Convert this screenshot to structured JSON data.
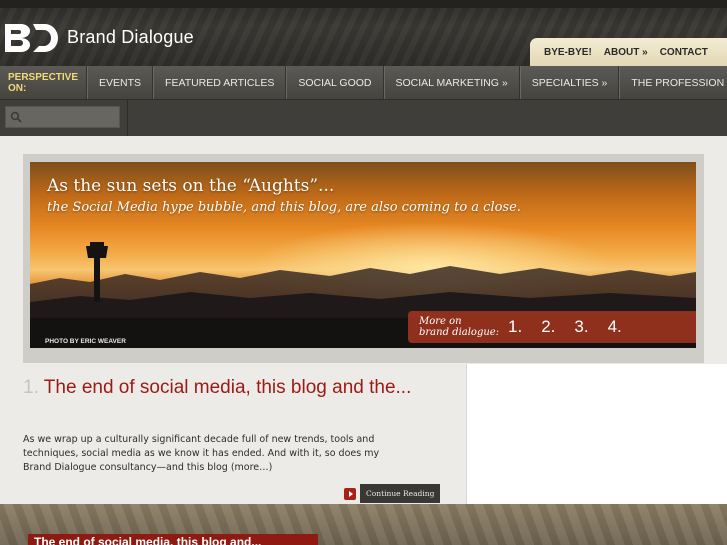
{
  "brand": {
    "name": "Brand Dialogue",
    "logo_icon": "bd-logo-icon"
  },
  "topnav": {
    "items": [
      "BYE-BYE!",
      "ABOUT »",
      "CONTACT"
    ]
  },
  "mainnav": {
    "label": "PERSPECTIVE ON:",
    "items": [
      "EVENTS",
      "FEATURED ARTICLES",
      "SOCIAL GOOD",
      "SOCIAL MARKETING »",
      "SPECIALTIES »",
      "THE PROFESSION »"
    ]
  },
  "search": {
    "icon": "search-icon",
    "value": ""
  },
  "feature": {
    "title": "As the sun sets on the “Aughts”...",
    "subtitle": "the Social Media hype bubble, and this blog, are also coming to a close.",
    "photo_credit": "PHOTO BY ERIC WEAVER",
    "more_label_line1": "More on",
    "more_label_line2": "brand dialogue:",
    "numbers": [
      "1.",
      "2.",
      "3.",
      "4."
    ]
  },
  "article": {
    "number": "1.",
    "title": "The end of social media, this blog and the...",
    "body": "As we wrap up a culturally significant decade full of new trends, tools and techniques, social media as we know it has ended. And with it, so does my Brand Dialogue consultancy—and this blog (more…)",
    "continue_label": "Continue Reading"
  },
  "bottom": {
    "title": "The end of social media, this blog and..."
  },
  "colors": {
    "accent_red": "#9c1a14",
    "nav_label": "#f2d978",
    "topnav_bg": "#f3ecd3"
  }
}
